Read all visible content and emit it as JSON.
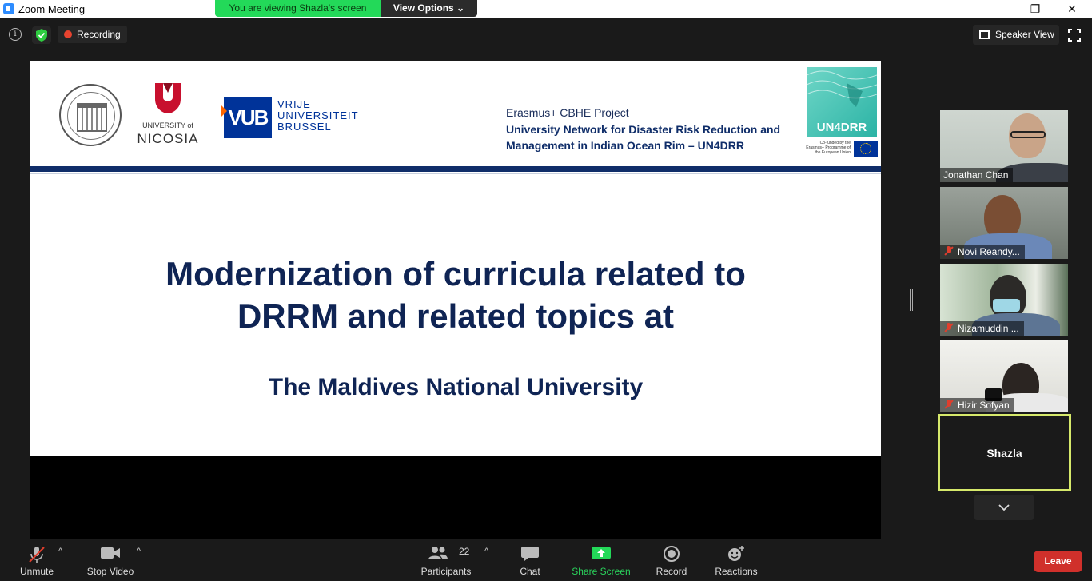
{
  "window": {
    "title": "Zoom Meeting",
    "minimize": "—",
    "restore": "❐",
    "close": "✕"
  },
  "banner": {
    "viewing": "You are viewing Shazla's screen",
    "view_options": "View Options ⌄"
  },
  "topbar": {
    "recording": "Recording",
    "speaker_view": "Speaker View"
  },
  "slide": {
    "university_line": "UNIVERSITY of",
    "university_name": "NICOSIA",
    "vub": "VUB",
    "vub_text": [
      "VRIJE",
      "UNIVERSITEIT",
      "BRUSSEL"
    ],
    "project_label": "Erasmus+ CBHE Project",
    "project_name": "University Network for Disaster Risk Reduction and Management in Indian Ocean Rim – UN4DRR",
    "un4drr": "UN4DRR",
    "eu_note": "Co-funded by the Erasmus+ Programme of the European Union",
    "title_line1": "Modernization of curricula related to",
    "title_line2": "DRRM and related topics at",
    "subtitle": "The Maldives National University"
  },
  "participants": [
    {
      "name": "Jonathan Chan",
      "muted": false
    },
    {
      "name": "Novi Reandy...",
      "muted": true
    },
    {
      "name": "Nizamuddin ...",
      "muted": true
    },
    {
      "name": "Hizir Sofyan",
      "muted": true
    }
  ],
  "self": {
    "name": "Shazla"
  },
  "toolbar": {
    "unmute": "Unmute",
    "stop_video": "Stop Video",
    "participants": "Participants",
    "participant_count": "22",
    "chat": "Chat",
    "share_screen": "Share Screen",
    "record": "Record",
    "reactions": "Reactions",
    "leave": "Leave"
  },
  "colors": {
    "share_green": "#23d959",
    "leave_red": "#d0302b",
    "slide_navy": "#0f2454",
    "active_border": "#d6e96b"
  }
}
